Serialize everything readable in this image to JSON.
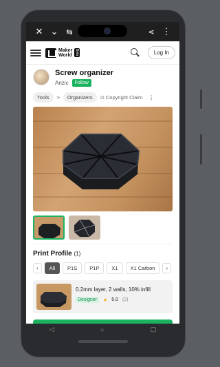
{
  "sysbar": {
    "close_icon": "close-icon",
    "dropdown_icon": "chevron-down-icon",
    "tune_icon": "tune-icon",
    "crop_icon": "crop-icon",
    "close2_icon": "close-icon",
    "share_icon": "share-icon",
    "more_icon": "more-vert-icon"
  },
  "appbar": {
    "brand_line1": "Maker",
    "brand_line2": "World",
    "beta": "Beta",
    "login_label": "Log In"
  },
  "model": {
    "title": "Screw organizer",
    "author": "Anzic",
    "follow_label": "Follow"
  },
  "breadcrumbs": {
    "root": "Tools",
    "sep": ">",
    "leaf": "Organizers",
    "claim": "Copyright Claim",
    "more": "⋮"
  },
  "print_profile": {
    "title": "Print Profile",
    "count": "(1)",
    "filters": [
      "All",
      "P1S",
      "P1P",
      "X1",
      "X1 Carbon"
    ],
    "active_filter": "All",
    "card": {
      "description": "0.2mm layer, 2 walls, 10% infill",
      "badge": "Designer",
      "rating": "5.0",
      "rating_count": "(2)"
    }
  },
  "colors": {
    "accent": "#1bb260",
    "sysbar": "#1f1f1f"
  }
}
